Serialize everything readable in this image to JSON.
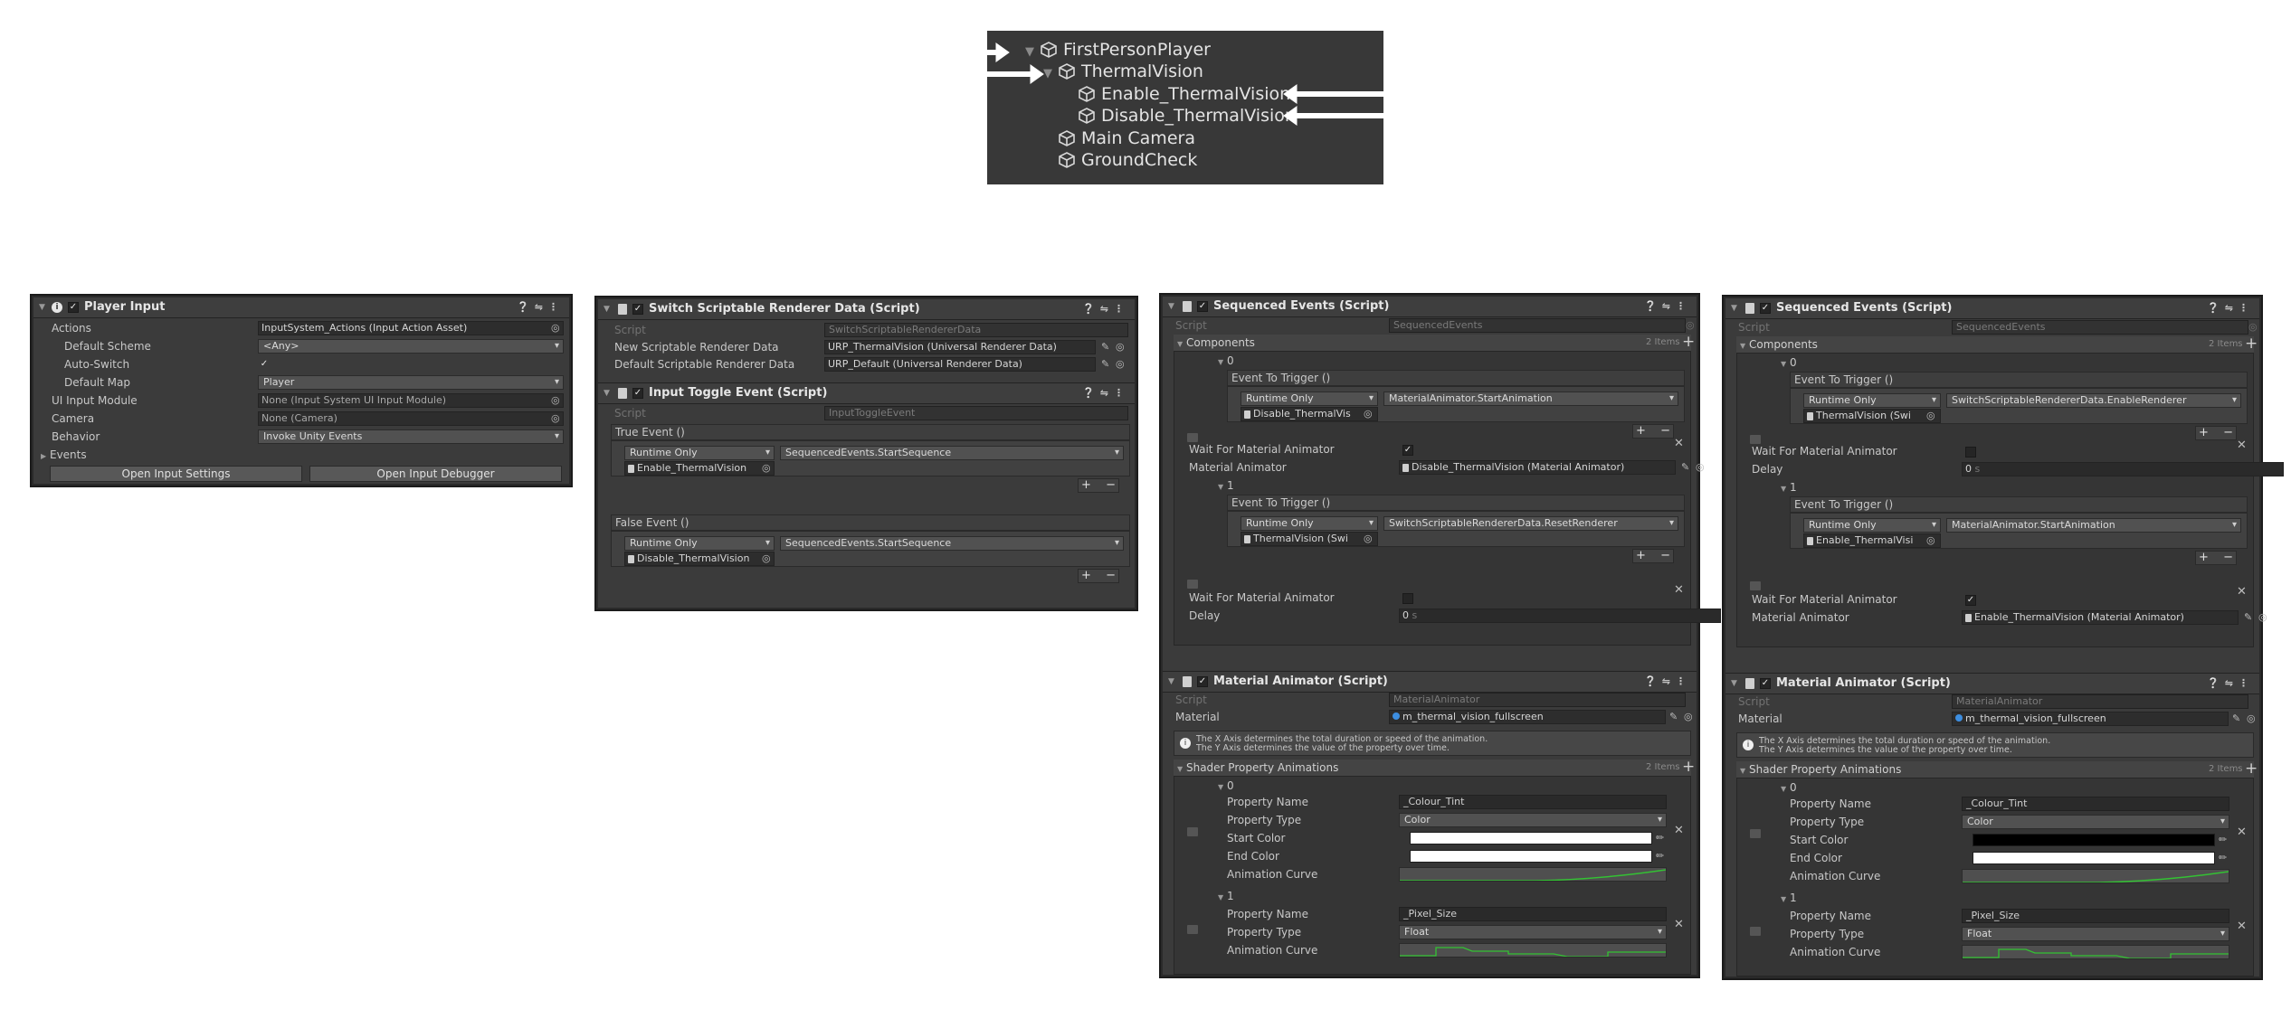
{
  "hierarchy": {
    "items": [
      {
        "label": "FirstPersonPlayer"
      },
      {
        "label": "ThermalVision"
      },
      {
        "label": "Enable_ThermalVision"
      },
      {
        "label": "Disable_ThermalVision"
      },
      {
        "label": "Main Camera"
      },
      {
        "label": "GroundCheck"
      }
    ]
  },
  "player_input": {
    "title": "Player Input",
    "actions_label": "Actions",
    "actions_value": "InputSystem_Actions (Input Action Asset)",
    "default_scheme_label": "Default Scheme",
    "default_scheme_value": "<Any>",
    "auto_switch_label": "Auto-Switch",
    "default_map_label": "Default Map",
    "default_map_value": "Player",
    "ui_input_module_label": "UI Input Module",
    "ui_input_module_value": "None (Input System UI Input Module)",
    "camera_label": "Camera",
    "camera_value": "None (Camera)",
    "behavior_label": "Behavior",
    "behavior_value": "Invoke Unity Events",
    "events_label": "Events",
    "open_settings_label": "Open Input Settings",
    "open_debugger_label": "Open Input Debugger"
  },
  "switch_renderer": {
    "title": "Switch Scriptable Renderer Data (Script)",
    "script_label": "Script",
    "script_value": "SwitchScriptableRendererData",
    "new_label": "New Scriptable Renderer Data",
    "new_value": "URP_ThermalVision (Universal Renderer Data)",
    "default_label": "Default Scriptable Renderer Data",
    "default_value": "URP_Default (Universal Renderer Data)"
  },
  "input_toggle": {
    "title": "Input Toggle Event (Script)",
    "script_label": "Script",
    "script_value": "InputToggleEvent",
    "true_event_label": "True Event ()",
    "true_mode": "Runtime Only",
    "true_function": "SequencedEvents.StartSequence",
    "true_object": "Enable_ThermalVision",
    "false_event_label": "False Event ()",
    "false_mode": "Runtime Only",
    "false_function": "SequencedEvents.StartSequence",
    "false_object": "Disable_ThermalVision"
  },
  "panels": [
    {
      "seq_title": "Sequenced Events (Script)",
      "script_label": "Script",
      "seq_script": "SequencedEvents",
      "components_label": "Components",
      "components_count": "2 Items",
      "el0_label": "0",
      "el0_event_label": "Event To Trigger ()",
      "el0_mode": "Runtime Only",
      "el0_function": "MaterialAnimator.StartAnimation",
      "el0_object": "Disable_ThermalVis",
      "el0_wait_label": "Wait For Material Animator",
      "el0_extra_label": "Material Animator",
      "el0_extra_value": "Disable_ThermalVision (Material Animator)",
      "el1_label": "1",
      "el1_event_label": "Event To Trigger ()",
      "el1_mode": "Runtime Only",
      "el1_function": "SwitchScriptableRendererData.ResetRenderer",
      "el1_object": "ThermalVision (Swi",
      "el1_wait_label": "Wait For Material Animator",
      "el1_extra_label": "Delay",
      "el1_extra_value": "0",
      "mat_title": "Material Animator (Script)",
      "mat_script": "MaterialAnimator",
      "material_label": "Material",
      "material_value": "m_thermal_vision_fullscreen",
      "note_line1": "The X Axis determines the total duration or speed of the animation.",
      "note_line2": "The Y Axis determines the value of the property over time.",
      "shader_label": "Shader Property Animations",
      "shader_count": "2 Items",
      "sp0_label": "0",
      "prop_name_label": "Property Name",
      "sp0_name": "_Colour_Tint",
      "prop_type_label": "Property Type",
      "sp0_type": "Color",
      "start_color_label": "Start Color",
      "end_color_label": "End Color",
      "anim_curve_label": "Animation Curve",
      "sp1_label": "1",
      "sp1_name": "_Pixel_Size",
      "sp1_type": "Float",
      "start_color": "#ffffff",
      "end_color": "#ffffff"
    },
    {
      "seq_title": "Sequenced Events (Script)",
      "script_label": "Script",
      "seq_script": "SequencedEvents",
      "components_label": "Components",
      "components_count": "2 Items",
      "el0_label": "0",
      "el0_event_label": "Event To Trigger ()",
      "el0_mode": "Runtime Only",
      "el0_function": "SwitchScriptableRendererData.EnableRenderer",
      "el0_object": "ThermalVision (Swi",
      "el0_wait_label": "Wait For Material Animator",
      "el0_extra_label": "Delay",
      "el0_extra_value": "0",
      "el1_label": "1",
      "el1_event_label": "Event To Trigger ()",
      "el1_mode": "Runtime Only",
      "el1_function": "MaterialAnimator.StartAnimation",
      "el1_object": "Enable_ThermalVisi",
      "el1_wait_label": "Wait For Material Animator",
      "el1_extra_label": "Material Animator",
      "el1_extra_value": "Enable_ThermalVision (Material Animator)",
      "mat_title": "Material Animator (Script)",
      "mat_script": "MaterialAnimator",
      "material_label": "Material",
      "material_value": "m_thermal_vision_fullscreen",
      "note_line1": "The X Axis determines the total duration or speed of the animation.",
      "note_line2": "The Y Axis determines the value of the property over time.",
      "shader_label": "Shader Property Animations",
      "shader_count": "2 Items",
      "sp0_label": "0",
      "prop_name_label": "Property Name",
      "sp0_name": "_Colour_Tint",
      "prop_type_label": "Property Type",
      "sp0_type": "Color",
      "start_color_label": "Start Color",
      "end_color_label": "End Color",
      "anim_curve_label": "Animation Curve",
      "sp1_label": "1",
      "sp1_name": "_Pixel_Size",
      "sp1_type": "Float",
      "start_color": "#000000",
      "end_color": "#ffffff"
    }
  ],
  "colors": {
    "inspector_bg": "#3b3b3b",
    "curve_green": "#33c233"
  }
}
